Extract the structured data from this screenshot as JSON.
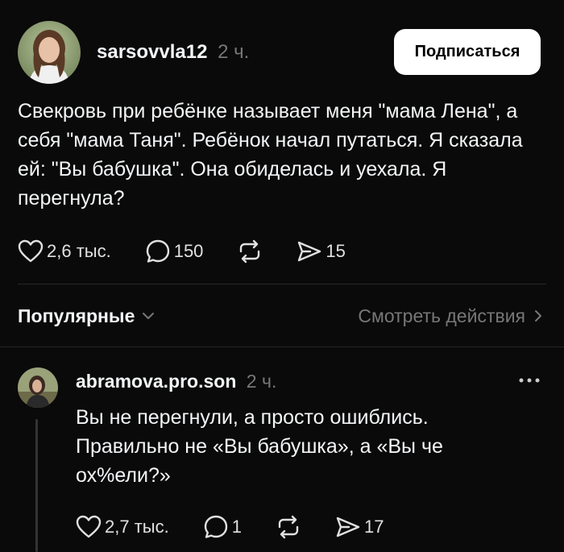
{
  "post": {
    "author": {
      "username": "sarsovvla12",
      "time": "2 ч.",
      "avatar_icon": "profile-photo"
    },
    "follow_label": "Подписаться",
    "text": "Свекровь при ребёнке называет меня \"мама Лена\", а себя \"мама Таня\". Ребёнок начал путаться. Я сказала ей: \"Вы бабушка\". Она обиделась и уехала. Я перегнула?",
    "likes": "2,6 тыс.",
    "comments": "150",
    "shares": "15"
  },
  "sort": {
    "label": "Популярные",
    "view_activity": "Смотреть действия"
  },
  "reply": {
    "author": {
      "username": "abramova.pro.son",
      "time": "2 ч.",
      "avatar_icon": "profile-photo"
    },
    "text": "Вы не перегнули, а просто ошиблись. Правильно не «Вы бабушка», а «Вы че ох%ели?»",
    "likes": "2,7 тыс.",
    "comments": "1",
    "shares": "17"
  },
  "colors": {
    "background": "#0a0a0a",
    "text": "#f3f5f7",
    "muted": "#777777",
    "button_bg": "#ffffff"
  }
}
